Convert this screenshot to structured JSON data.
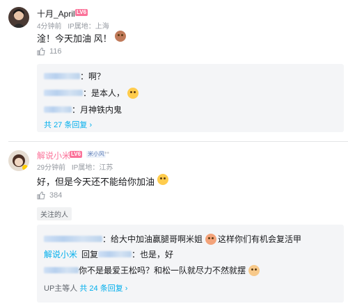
{
  "comment1": {
    "username": "十月_April",
    "level": "LV6",
    "time": "4分钟前",
    "ip": "IP属地：上海",
    "text": "淦！今天加油 风！",
    "likes": "116",
    "replies": [
      {
        "text": "：啊？"
      },
      {
        "text": "：是本人，"
      },
      {
        "text": "：月神铁内鬼"
      }
    ],
    "more": {
      "prefix": "共",
      "count": "27",
      "suffix": "条回复"
    }
  },
  "comment2": {
    "username": "解说小米",
    "level": "LV6",
    "fan_badge": "米小风",
    "time": "29分钟前",
    "ip": "IP属地：江苏",
    "text": "好，但是今天还不能给你加油",
    "likes": "384",
    "tag": "关注的人",
    "replies": [
      {
        "text": "：给大中加油赢腿哥啊米姐",
        "suffix": "这样你们有机会复活甲"
      },
      {
        "user": "解说小米",
        "mid": "回复",
        "text": "：也是，好"
      },
      {
        "text": "你不是最爱王松吗？和松一队就尽力不然就摆"
      }
    ],
    "more": {
      "prefix": "UP主等人",
      "count": "共 24 条回复"
    }
  },
  "colors": {
    "blue": "#00aeec",
    "level": "#fb7299",
    "gray": "#9499a0"
  }
}
